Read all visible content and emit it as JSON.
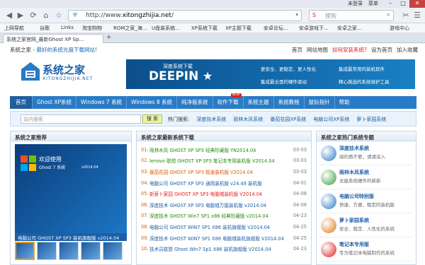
{
  "titlebar": {
    "user": "未登录",
    "menu": "菜单"
  },
  "navbar": {
    "url_prefix": "http://www.",
    "url_domain": "xitongzhijia.net",
    "url_suffix": "/",
    "search_placeholder": "搜狗"
  },
  "bookmarks": [
    "上网导航",
    "谷歌",
    "Links",
    "淘宝购物",
    "ROM之家_海…",
    "U盘装系统…",
    "XP系统下载",
    "XP主题下载",
    "安卓论坛…",
    "安卓游戏下…",
    "安卓之家…",
    "游戏中心"
  ],
  "tab": {
    "title": "系统之家官网_最新Ghost XP Sp…",
    "new_tab": "+"
  },
  "page": {
    "tagline_prefix": "系统之家 - ",
    "tagline": "最好的系统光盘下载网站!",
    "toplinks": [
      "首页",
      "网站地图",
      "如何安装系统?",
      "设为首页",
      "加入收藏"
    ],
    "logo_title": "系统之家",
    "logo_sub": "XITONGZHIJIA.NET",
    "banner": {
      "small": "深度系统下载",
      "big": "DEEPIN",
      "features": [
        "更安全、更稳定、更人性化",
        "集成最常用的装机软件",
        "集成最全面的硬件驱动",
        "精心挑选的系统维护工具"
      ]
    },
    "nav": [
      "首页",
      "Ghost XP系统",
      "Windows 7 系统",
      "Windows 8 系统",
      "纯净版系统",
      "软件下载",
      "系统主题",
      "系统教程",
      "鼠标指针",
      "帮助"
    ],
    "nav_new_badge": "NEW",
    "search_placeholder": "站内搜索",
    "search_button": "搜 索",
    "hot_label": "热门搜索:",
    "hot_links": [
      "深度技术系统",
      "雨林木风系统",
      "番茄花园XP系统",
      "电脑公司XP系统",
      "萝卜家园系统"
    ],
    "left_panel": {
      "title": "系统之家推荐",
      "welcome": "欢迎使用",
      "ghost": "Ghost 7 系统",
      "version": "v2014.04",
      "caption": "电脑公司 GHOST XP SP3 装机旗舰版 v2014.04"
    },
    "middle_panel": {
      "title": "系统之家最新系统下载",
      "rows": [
        {
          "num": "01.",
          "title": "雨林木风 GHOST XP SP3 经典珍藏版 YN2014.04",
          "date": "03-03",
          "color": "#2a8a10"
        },
        {
          "num": "02.",
          "title": "lenovo 联想 GHOST XP SP3 笔记本专用装机版 V2014.04",
          "date": "03-03",
          "color": "#2a8a10"
        },
        {
          "num": "03.",
          "title": "番茄花园 GHOST XP SP3 极速装机版 V2014.04",
          "date": "03-03",
          "color": "#e05a00"
        },
        {
          "num": "04.",
          "title": "电脑公司 GHOST XP SP3 通用装机版 v24.49 装机版",
          "date": "04-01",
          "color": "#1a5fa8"
        },
        {
          "num": "05.",
          "title": "新萝卜家园 GHOST XP SP3 电脑城装机版 V2014.04",
          "date": "04-08",
          "color": "#e02020"
        },
        {
          "num": "06.",
          "title": "深度技术 GHOST XP SP3 电脑城万能装机版 v2014.04",
          "date": "04-08",
          "color": "#1a5fa8"
        },
        {
          "num": "07.",
          "title": "深度技术 GHOST Win7 SP1 x86 经典珍藏版 v2014.04",
          "date": "04-23",
          "color": "#2a8a10"
        },
        {
          "num": "08.",
          "title": "电脑公司 GHOST WIN7 SP1 X86 装机旗舰版 V2014.04",
          "date": "04-25",
          "color": "#1a5fa8"
        },
        {
          "num": "09.",
          "title": "深度技术 GHOST WIN7 SP1 X86 电脑城装机旗舰版 V2014.04",
          "date": "04-25",
          "color": "#1a5fa8"
        },
        {
          "num": "10.",
          "title": "技术员联盟 Ghost Win7 Sp1 X86 装机旗舰版 V2014.04",
          "date": "04-23",
          "color": "#1a5fa8"
        }
      ]
    },
    "right_panel": {
      "title": "系统之家热门系统专题",
      "items": [
        {
          "name": "深度技术系统",
          "desc": "骑的再不要，请请深入",
          "color": "#2a7bc5"
        },
        {
          "name": "雨林木风系统",
          "desc": "无敌系统硬件的新新",
          "color": "#3aa040"
        },
        {
          "name": "电脑公司特别版",
          "desc": "快速、方便、稳定的装机版",
          "color": "#2a7bc5"
        },
        {
          "name": "萝卜家园系统",
          "desc": "安全、稳定、人性化的系统",
          "color": "#e07a20"
        },
        {
          "name": "笔记本专用版",
          "desc": "专为笔记本电脑制作的系统",
          "color": "#e02020"
        }
      ]
    }
  }
}
